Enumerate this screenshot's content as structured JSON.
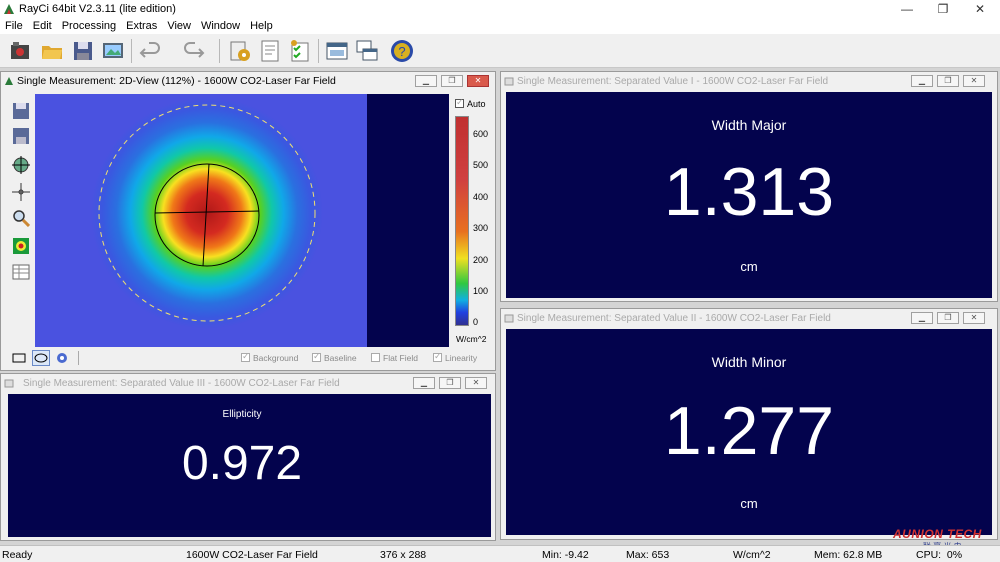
{
  "app": {
    "title": "RayCi 64bit V2.3.11 (lite edition)"
  },
  "window_controls": {
    "minimize": "—",
    "restore": "❐",
    "close": "✕"
  },
  "menu": [
    "File",
    "Edit",
    "Processing",
    "Extras",
    "View",
    "Window",
    "Help"
  ],
  "toolbar_icons": [
    "camera-icon",
    "open-folder-icon",
    "save-icon",
    "image-export-icon",
    "undo-icon",
    "redo-icon",
    "settings-icon",
    "report-icon",
    "checklist-icon",
    "window-icon",
    "cascade-windows-icon",
    "help-icon"
  ],
  "view2d": {
    "title": "Single Measurement: 2D-View (112%) - 1600W CO2-Laser Far Field",
    "auto_label": "Auto",
    "auto_checked": true,
    "scale_ticks": [
      "600",
      "500",
      "400",
      "300",
      "200",
      "100",
      "0"
    ],
    "unit": "W/cm^2",
    "checkboxes": [
      {
        "label": "Background",
        "checked": true
      },
      {
        "label": "Baseline",
        "checked": true
      },
      {
        "label": "Flat Field",
        "checked": false
      },
      {
        "label": "Linearity",
        "checked": true
      }
    ],
    "colors": {
      "background": "#4a52e0",
      "dark": "#03034d"
    }
  },
  "sep1": {
    "title": "Single Measurement: Separated Value I - 1600W CO2-Laser Far Field",
    "label": "Width Major",
    "value": "1.313",
    "unit": "cm"
  },
  "sep2": {
    "title": "Single Measurement: Separated Value II - 1600W CO2-Laser Far Field",
    "label": "Width Minor",
    "value": "1.277",
    "unit": "cm"
  },
  "sep3": {
    "title": "Single Measurement: Separated Value III - 1600W CO2-Laser Far Field",
    "label": "Ellipticity",
    "value": "0.972",
    "unit": ""
  },
  "watermark": {
    "text": "AUNION TECH",
    "subtext": "联 赢 光 电"
  },
  "status": {
    "state": "Ready",
    "name": "1600W CO2-Laser Far Field",
    "size": "376 x 288",
    "min": "Min: -9.42",
    "max": "Max: 653",
    "unit": "W/cm^2",
    "mem": "Mem: 62.8 MB",
    "cpu": "CPU:  0%"
  }
}
